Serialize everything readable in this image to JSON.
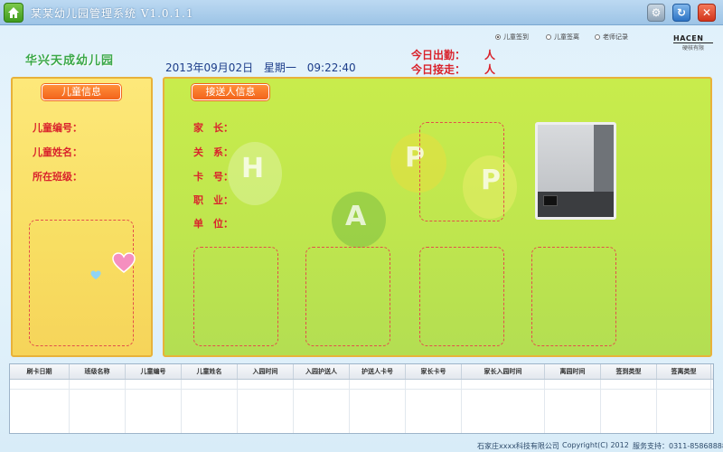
{
  "window": {
    "title": "某某幼儿园管理系统 V1.0.1.1",
    "icons": [
      "home-icon",
      "settings-icon",
      "minimize-icon",
      "close-icon"
    ]
  },
  "options": {
    "items": [
      {
        "label": "儿童签到",
        "checked": true
      },
      {
        "label": "儿童签离",
        "checked": false
      },
      {
        "label": "老师记录",
        "checked": false
      }
    ]
  },
  "brand": {
    "logo_text": "HACEN",
    "logo_sub": "硬核有限",
    "kindergarten_name": "华兴天成幼儿园"
  },
  "datetime": {
    "date": "2013年09月02日",
    "weekday": "星期一",
    "time": "09:22:40"
  },
  "stats": {
    "attendance_label": "今日出勤：",
    "attendance_value": "人",
    "pickup_label": "今日接走：",
    "pickup_value": "人"
  },
  "child_panel": {
    "header": "儿童信息",
    "fields": [
      "儿童编号：",
      "儿童姓名：",
      "所在班级："
    ]
  },
  "picker_panel": {
    "header": "接送人信息",
    "fields": [
      "家　长：",
      "关　系：",
      "卡　号：",
      "职　业：",
      "单　位："
    ],
    "balloon_letters": [
      "H",
      "A",
      "P",
      "P"
    ]
  },
  "table": {
    "columns": [
      "刷卡日期",
      "班级名称",
      "儿童编号",
      "儿童姓名",
      "入园时间",
      "入园护送人",
      "护送人卡号",
      "家长卡号",
      "家长入园时间",
      "离园时间",
      "签到类型",
      "签离类型"
    ]
  },
  "footer": {
    "company": "石家庄xxxx科技有限公司",
    "copyright": "Copyright(C) 2012",
    "support": "服务支持：0311-85868888"
  },
  "colors": {
    "accent_red": "#d9232c",
    "header_orange": "#f2631b",
    "left_panel": "#f8de62",
    "right_panel": "#bfe64e"
  }
}
